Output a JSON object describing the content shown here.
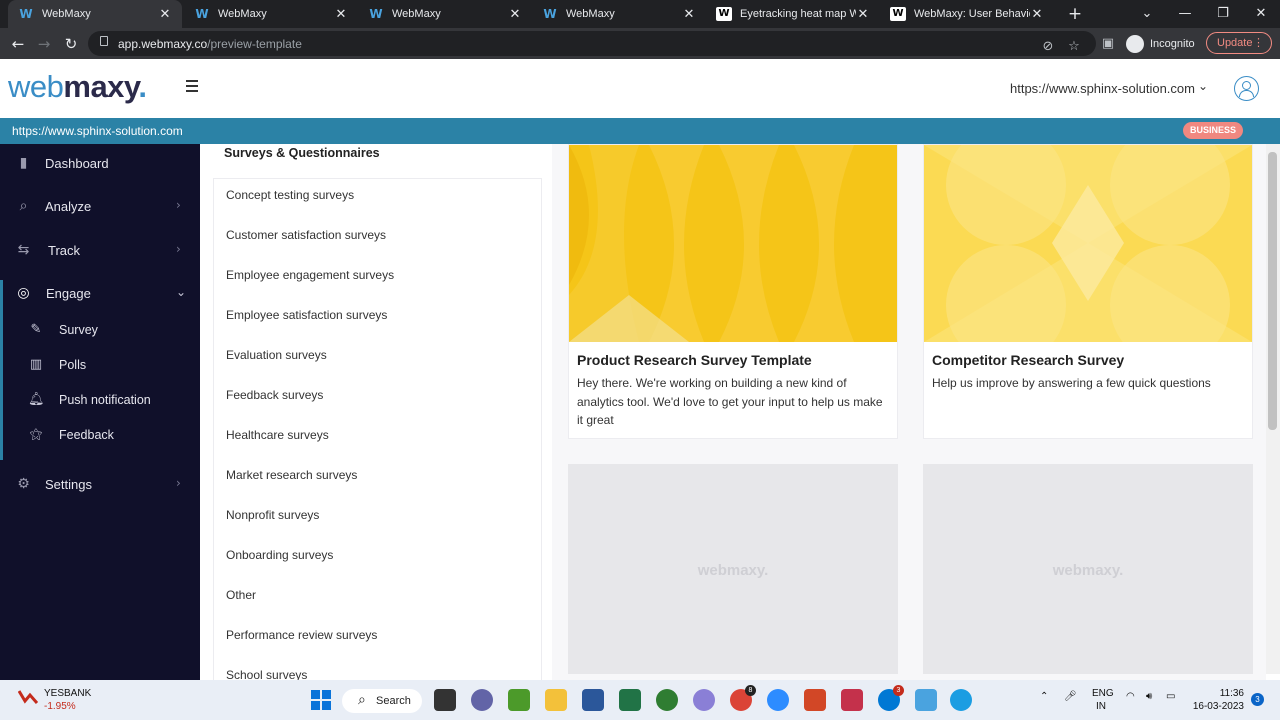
{
  "browser": {
    "tabs": [
      {
        "label": "WebMaxy",
        "icon": "W",
        "active": true
      },
      {
        "label": "WebMaxy",
        "icon": "W",
        "active": false
      },
      {
        "label": "WebMaxy",
        "icon": "W",
        "active": false
      },
      {
        "label": "WebMaxy",
        "icon": "W",
        "active": false
      },
      {
        "label": "Eyetracking heat map Wiki",
        "icon": "W",
        "active": false
      },
      {
        "label": "WebMaxy: User Behavior A",
        "icon": "W",
        "active": false
      }
    ],
    "url_host": "app.webmaxy.co",
    "url_path": "/preview-template",
    "incognito_label": "Incognito",
    "update_label": "Update"
  },
  "header": {
    "logo_part1": "web",
    "logo_part2": "maxy",
    "logo_dot": ".",
    "site_selector": "https://www.sphinx-solution.com",
    "site_strip_url": "https://www.sphinx-solution.com",
    "plan_badge": "BUSINESS"
  },
  "sidebar": {
    "items": [
      {
        "label": "Dashboard",
        "icon": "bar-chart-icon",
        "chevron": false
      },
      {
        "label": "Analyze",
        "icon": "analyze-icon",
        "chevron": true
      },
      {
        "label": "Track",
        "icon": "track-icon",
        "chevron": true
      },
      {
        "label": "Engage",
        "icon": "engage-icon",
        "chevron": true,
        "expanded": true
      },
      {
        "label": "Settings",
        "icon": "gear-icon",
        "chevron": true
      }
    ],
    "engage_subitems": [
      {
        "label": "Survey",
        "icon": "survey-icon"
      },
      {
        "label": "Polls",
        "icon": "polls-icon"
      },
      {
        "label": "Push notification",
        "icon": "bell-icon"
      },
      {
        "label": "Feedback",
        "icon": "star-icon"
      }
    ]
  },
  "categories": {
    "title": "Surveys & Questionnaires",
    "items": [
      "Concept testing surveys",
      "Customer satisfaction surveys",
      "Employee engagement surveys",
      "Employee satisfaction surveys",
      "Evaluation surveys",
      "Feedback surveys",
      "Healthcare surveys",
      "Market research surveys",
      "Nonprofit surveys",
      "Onboarding surveys",
      "Other",
      "Performance review surveys",
      "School surveys"
    ]
  },
  "templates": [
    {
      "title": "Product Research Survey Template",
      "description": "Hey there. We're working on building a new kind of analytics tool. We'd love to get your input to help us make it great",
      "thumb_color": "#f5c518"
    },
    {
      "title": "Competitor Research Survey",
      "description": "Help us improve by answering a few quick questions",
      "thumb_color": "#fbe06a"
    }
  ],
  "placeholder_logo": "webmaxy.",
  "taskbar": {
    "stock_symbol": "YESBANK",
    "stock_change": "-1.95%",
    "search_label": "Search",
    "lang_line1": "ENG",
    "lang_line2": "IN",
    "time": "11:36",
    "date": "16-03-2023",
    "notification_count": "3",
    "chrome_badge": "8",
    "mail_badge": "3"
  }
}
